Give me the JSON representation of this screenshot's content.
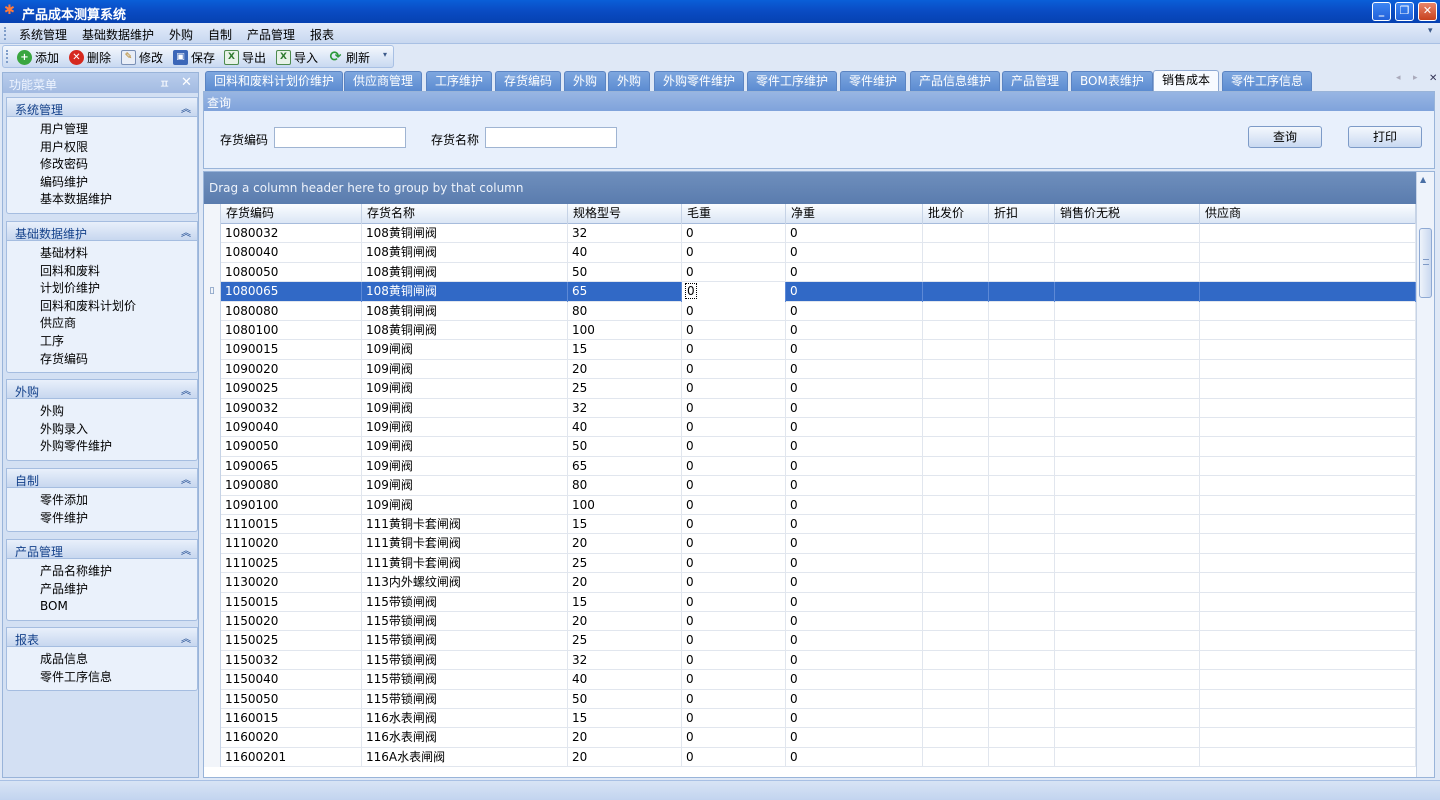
{
  "window": {
    "title": "产品成本测算系统"
  },
  "menubar": {
    "items": [
      "系统管理",
      "基础数据维护",
      "外购",
      "自制",
      "产品管理",
      "报表"
    ]
  },
  "toolbar": {
    "buttons": [
      {
        "label": "添加",
        "icon": "add-icon"
      },
      {
        "label": "删除",
        "icon": "delete-icon"
      },
      {
        "label": "修改",
        "icon": "edit-icon"
      },
      {
        "label": "保存",
        "icon": "save-icon"
      },
      {
        "label": "导出",
        "icon": "export-icon"
      },
      {
        "label": "导入",
        "icon": "import-icon"
      },
      {
        "label": "刷新",
        "icon": "refresh-icon"
      }
    ]
  },
  "sidebar": {
    "title": "功能菜单",
    "groups": [
      {
        "title": "系统管理",
        "items": [
          "用户管理",
          "用户权限",
          "修改密码",
          "编码维护",
          "基本数据维护"
        ]
      },
      {
        "title": "基础数据维护",
        "items": [
          "基础材料",
          "回料和废料",
          "计划价维护",
          "回料和废料计划价",
          "供应商",
          "工序",
          "存货编码"
        ]
      },
      {
        "title": "外购",
        "items": [
          "外购",
          "外购录入",
          "外购零件维护"
        ]
      },
      {
        "title": "自制",
        "items": [
          "零件添加",
          "零件维护"
        ]
      },
      {
        "title": "产品管理",
        "items": [
          "产品名称维护",
          "产品维护",
          "BOM"
        ]
      },
      {
        "title": "报表",
        "items": [
          "成品信息",
          "零件工序信息"
        ]
      }
    ]
  },
  "tabs": {
    "items": [
      "回料和废料计划价维护",
      "供应商管理",
      "工序维护",
      "存货编码",
      "外购",
      "外购",
      "外购零件维护",
      "零件工序维护",
      "零件维护",
      "产品信息维护",
      "产品管理",
      "BOM表维护",
      "销售成本",
      "零件工序信息"
    ],
    "active": 12
  },
  "query": {
    "title": "查询",
    "code_label": "存货编码",
    "code_value": "",
    "name_label": "存货名称",
    "name_value": "",
    "search_button": "查询",
    "print_button": "打印"
  },
  "grid": {
    "group_hint": "Drag a column header here to group by that column",
    "columns": [
      "存货编码",
      "存货名称",
      "规格型号",
      "毛重",
      "净重",
      "批发价",
      "折扣",
      "销售价无税",
      "供应商"
    ],
    "selected_row": 3,
    "rows": [
      [
        "1080032",
        "108黄铜闸阀",
        "32",
        "0",
        "0",
        "",
        "",
        "",
        ""
      ],
      [
        "1080040",
        "108黄铜闸阀",
        "40",
        "0",
        "0",
        "",
        "",
        "",
        ""
      ],
      [
        "1080050",
        "108黄铜闸阀",
        "50",
        "0",
        "0",
        "",
        "",
        "",
        ""
      ],
      [
        "1080065",
        "108黄铜闸阀",
        "65",
        "0",
        "0",
        "",
        "",
        "",
        ""
      ],
      [
        "1080080",
        "108黄铜闸阀",
        "80",
        "0",
        "0",
        "",
        "",
        "",
        ""
      ],
      [
        "1080100",
        "108黄铜闸阀",
        "100",
        "0",
        "0",
        "",
        "",
        "",
        ""
      ],
      [
        "1090015",
        "109闸阀",
        "15",
        "0",
        "0",
        "",
        "",
        "",
        ""
      ],
      [
        "1090020",
        "109闸阀",
        "20",
        "0",
        "0",
        "",
        "",
        "",
        ""
      ],
      [
        "1090025",
        "109闸阀",
        "25",
        "0",
        "0",
        "",
        "",
        "",
        ""
      ],
      [
        "1090032",
        "109闸阀",
        "32",
        "0",
        "0",
        "",
        "",
        "",
        ""
      ],
      [
        "1090040",
        "109闸阀",
        "40",
        "0",
        "0",
        "",
        "",
        "",
        ""
      ],
      [
        "1090050",
        "109闸阀",
        "50",
        "0",
        "0",
        "",
        "",
        "",
        ""
      ],
      [
        "1090065",
        "109闸阀",
        "65",
        "0",
        "0",
        "",
        "",
        "",
        ""
      ],
      [
        "1090080",
        "109闸阀",
        "80",
        "0",
        "0",
        "",
        "",
        "",
        ""
      ],
      [
        "1090100",
        "109闸阀",
        "100",
        "0",
        "0",
        "",
        "",
        "",
        ""
      ],
      [
        "1110015",
        "111黄铜卡套闸阀",
        "15",
        "0",
        "0",
        "",
        "",
        "",
        ""
      ],
      [
        "1110020",
        "111黄铜卡套闸阀",
        "20",
        "0",
        "0",
        "",
        "",
        "",
        ""
      ],
      [
        "1110025",
        "111黄铜卡套闸阀",
        "25",
        "0",
        "0",
        "",
        "",
        "",
        ""
      ],
      [
        "1130020",
        "113内外螺纹闸阀",
        "20",
        "0",
        "0",
        "",
        "",
        "",
        ""
      ],
      [
        "1150015",
        "115带锁闸阀",
        "15",
        "0",
        "0",
        "",
        "",
        "",
        ""
      ],
      [
        "1150020",
        "115带锁闸阀",
        "20",
        "0",
        "0",
        "",
        "",
        "",
        ""
      ],
      [
        "1150025",
        "115带锁闸阀",
        "25",
        "0",
        "0",
        "",
        "",
        "",
        ""
      ],
      [
        "1150032",
        "115带锁闸阀",
        "32",
        "0",
        "0",
        "",
        "",
        "",
        ""
      ],
      [
        "1150040",
        "115带锁闸阀",
        "40",
        "0",
        "0",
        "",
        "",
        "",
        ""
      ],
      [
        "1150050",
        "115带锁闸阀",
        "50",
        "0",
        "0",
        "",
        "",
        "",
        ""
      ],
      [
        "1160015",
        "116水表闸阀",
        "15",
        "0",
        "0",
        "",
        "",
        "",
        ""
      ],
      [
        "1160020",
        "116水表闸阀",
        "20",
        "0",
        "0",
        "",
        "",
        "",
        ""
      ],
      [
        "11600201",
        "116A水表闸阀",
        "20",
        "0",
        "0",
        "",
        "",
        "",
        ""
      ]
    ]
  }
}
